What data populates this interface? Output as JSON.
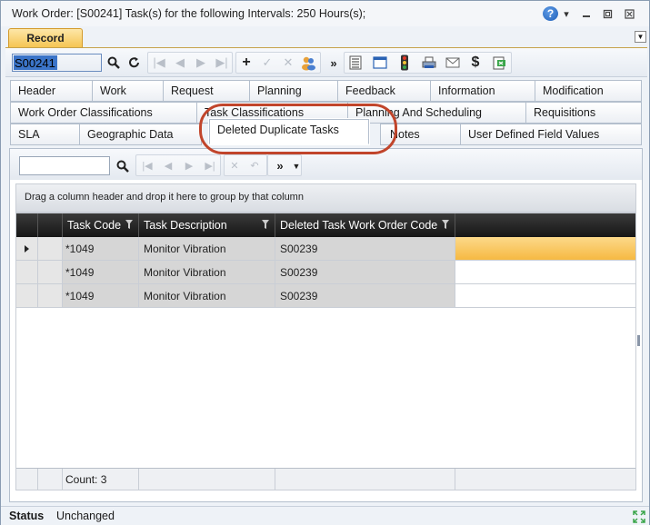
{
  "window": {
    "title": "Work Order: [S00241] Task(s) for the following Intervals: 250 Hours(s);"
  },
  "titlebar_icons": [
    "help-icon",
    "dropdown-icon",
    "minimize-icon",
    "restore-icon",
    "close-icon"
  ],
  "record_tab": {
    "label": "Record"
  },
  "toolbar": {
    "record_value": "S00241",
    "buttons": [
      "search-icon",
      "refresh-icon",
      "first-icon",
      "previous-icon",
      "next-icon",
      "last-icon",
      "add-icon",
      "save-icon",
      "delete-icon",
      "users-icon",
      "more-icon",
      "list-icon",
      "window-icon",
      "traffic-light-icon",
      "print-icon",
      "email-icon",
      "dollar-icon",
      "export-icon"
    ]
  },
  "tabs": {
    "row1": [
      "Header",
      "Work",
      "Request",
      "Planning",
      "Feedback",
      "Information",
      "Modification"
    ],
    "row2": [
      "Work Order Classifications",
      "Task Classifications",
      "Planning And Scheduling",
      "Requisitions"
    ],
    "row3": [
      "SLA",
      "Geographic Data",
      "Deleted Duplicate Tasks",
      "Notes",
      "User Defined Field Values"
    ],
    "active": "Deleted Duplicate Tasks"
  },
  "grid": {
    "group_hint": "Drag a column header and drop it here to group by that column",
    "columns": [
      "Task Code",
      "Task Description",
      "Deleted Task Work Order Code"
    ],
    "rows": [
      [
        "*1049",
        "Monitor Vibration",
        "S00239"
      ],
      [
        "*1049",
        "Monitor Vibration",
        "S00239"
      ],
      [
        "*1049",
        "Monitor Vibration",
        "S00239"
      ]
    ],
    "selected_row": 0,
    "footer_count": "Count: 3"
  },
  "status": {
    "label": "Status",
    "value": "Unchanged"
  },
  "colors": {
    "accent": "#f5c34f",
    "highlight_ring": "#c1452b",
    "header_bg": "#1e1e1e"
  }
}
